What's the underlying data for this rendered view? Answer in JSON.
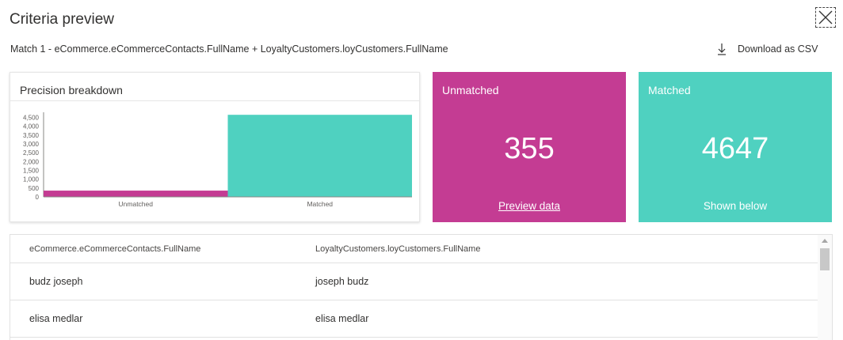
{
  "dialog": {
    "title": "Criteria preview",
    "subtitle": "Match 1 - eCommerce.eCommerceContacts.FullName + LoyaltyCustomers.loyCustomers.FullName",
    "download_label": "Download as CSV",
    "close_icon": "close-icon",
    "download_icon": "download-icon"
  },
  "chart": {
    "title": "Precision breakdown"
  },
  "chart_data": {
    "type": "bar",
    "categories": [
      "Unmatched",
      "Matched"
    ],
    "values": [
      355,
      4647
    ],
    "colors": [
      "#c43c93",
      "#4fd1c0"
    ],
    "yticks": [
      0,
      500,
      1000,
      1500,
      2000,
      2500,
      3000,
      3500,
      4000,
      4500
    ],
    "ytick_labels": [
      "0",
      "500",
      "1,000",
      "1,500",
      "2,000",
      "2,500",
      "3,000",
      "3,500",
      "4,000",
      "4,500"
    ],
    "ylim": [
      0,
      4700
    ],
    "grid": false,
    "xlabel": "",
    "ylabel": ""
  },
  "cards": {
    "unmatched": {
      "label": "Unmatched",
      "value": "355",
      "footer": "Preview data",
      "color": "#c43c93"
    },
    "matched": {
      "label": "Matched",
      "value": "4647",
      "footer": "Shown below",
      "color": "#4fd1c0"
    }
  },
  "table": {
    "columns": [
      "eCommerce.eCommerceContacts.FullName",
      "LoyaltyCustomers.loyCustomers.FullName"
    ],
    "rows": [
      [
        "budz joseph",
        "joseph budz"
      ],
      [
        "elisa medlar",
        "elisa medlar"
      ]
    ]
  }
}
